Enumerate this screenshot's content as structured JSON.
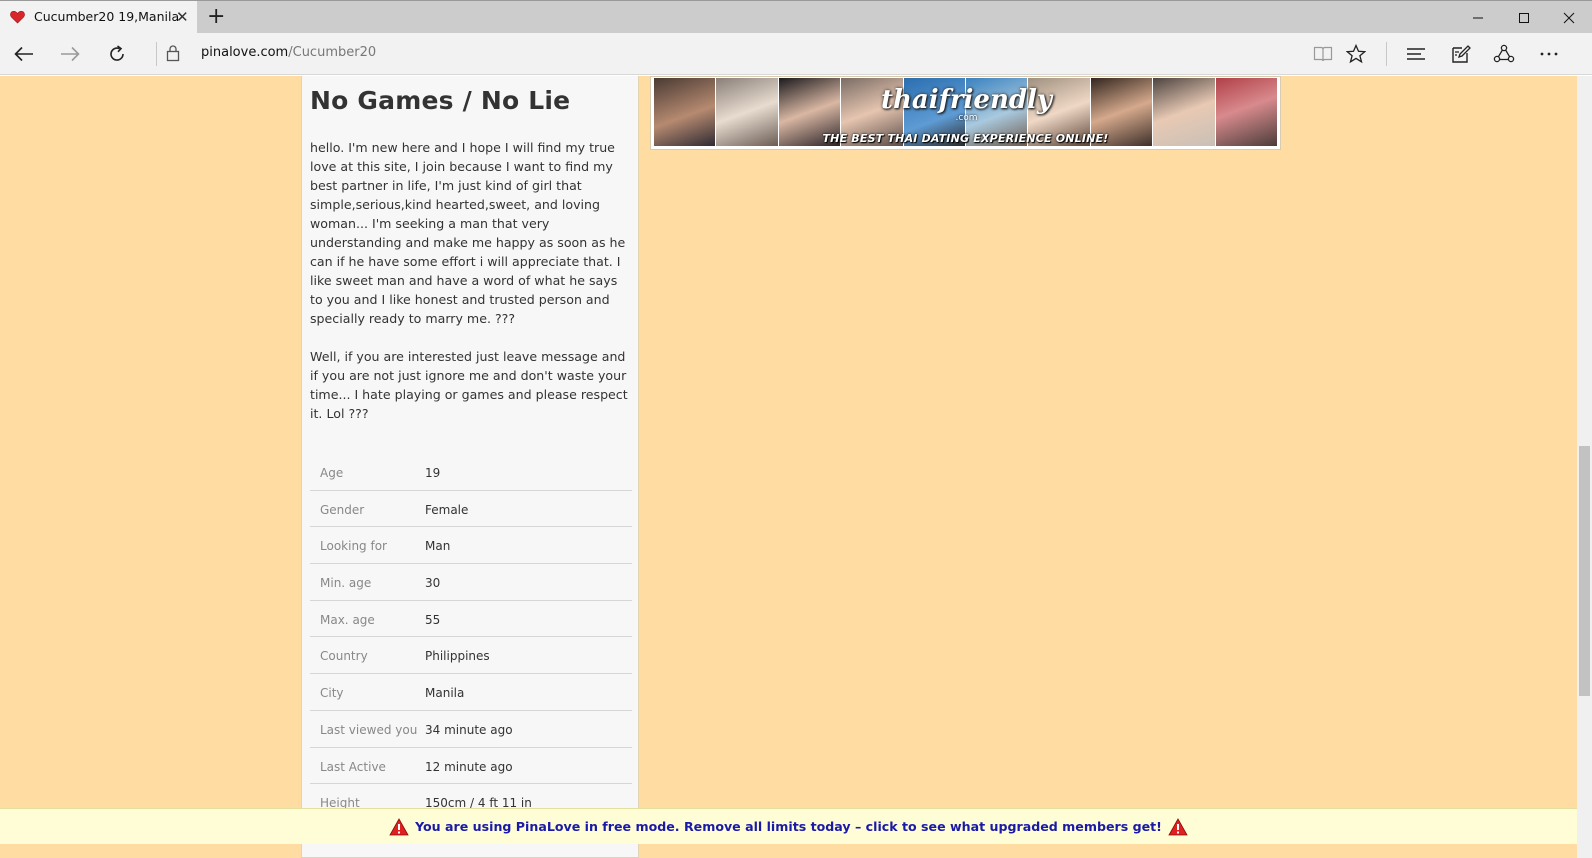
{
  "browser": {
    "tab_title": "Cucumber20 19,Manila",
    "url_host": "pinalove.com",
    "url_path": "/Cucumber20"
  },
  "profile": {
    "headline": "No Games / No Lie",
    "bio_paragraphs": [
      "hello. I'm new here and I hope I will find my true love at this site, I join because I want to find my best partner in life, I'm just kind of girl that simple,serious,kind hearted,sweet, and loving woman... I'm seeking a man that very understanding and make me happy as soon as he can if he have some effort i will appreciate that. I like sweet man and have a word of what he says to you and I like honest and trusted person and specially ready to marry me. ???",
      "Well, if you are interested just leave message and if you are not just ignore me and don't waste your time... I hate playing or games and please respect it. Lol ???"
    ],
    "info": [
      {
        "label": "Age",
        "value": "19"
      },
      {
        "label": "Gender",
        "value": "Female"
      },
      {
        "label": "Looking for",
        "value": "Man"
      },
      {
        "label": "Min. age",
        "value": "30"
      },
      {
        "label": "Max. age",
        "value": "55"
      },
      {
        "label": "Country",
        "value": "Philippines"
      },
      {
        "label": "City",
        "value": "Manila"
      },
      {
        "label": "Last viewed you",
        "value": "34 minute ago"
      },
      {
        "label": "Last Active",
        "value": "12 minute ago"
      },
      {
        "label": "Height",
        "value": "150cm / 4 ft 11 in"
      }
    ]
  },
  "banner": {
    "logo_text": "thaifriendly",
    "logo_sub": ".com",
    "tagline": "THE BEST THAI DATING EXPERIENCE ONLINE!"
  },
  "free_mode_notice": "You are using PinaLove in free mode. Remove all limits today – click to see what upgraded members get!",
  "colors": {
    "page_background": "#fedca2",
    "notice_text": "#1a1aa8",
    "warning_icon": "#e02020"
  },
  "icons": [
    "heart-favicon-icon",
    "close-icon",
    "plus-icon",
    "minimize-icon",
    "maximize-icon",
    "close-window-icon",
    "back-arrow-icon",
    "forward-arrow-icon",
    "refresh-icon",
    "lock-icon",
    "reading-view-icon",
    "star-icon",
    "hub-icon",
    "web-note-icon",
    "share-icon",
    "more-icon",
    "warning-icon"
  ]
}
